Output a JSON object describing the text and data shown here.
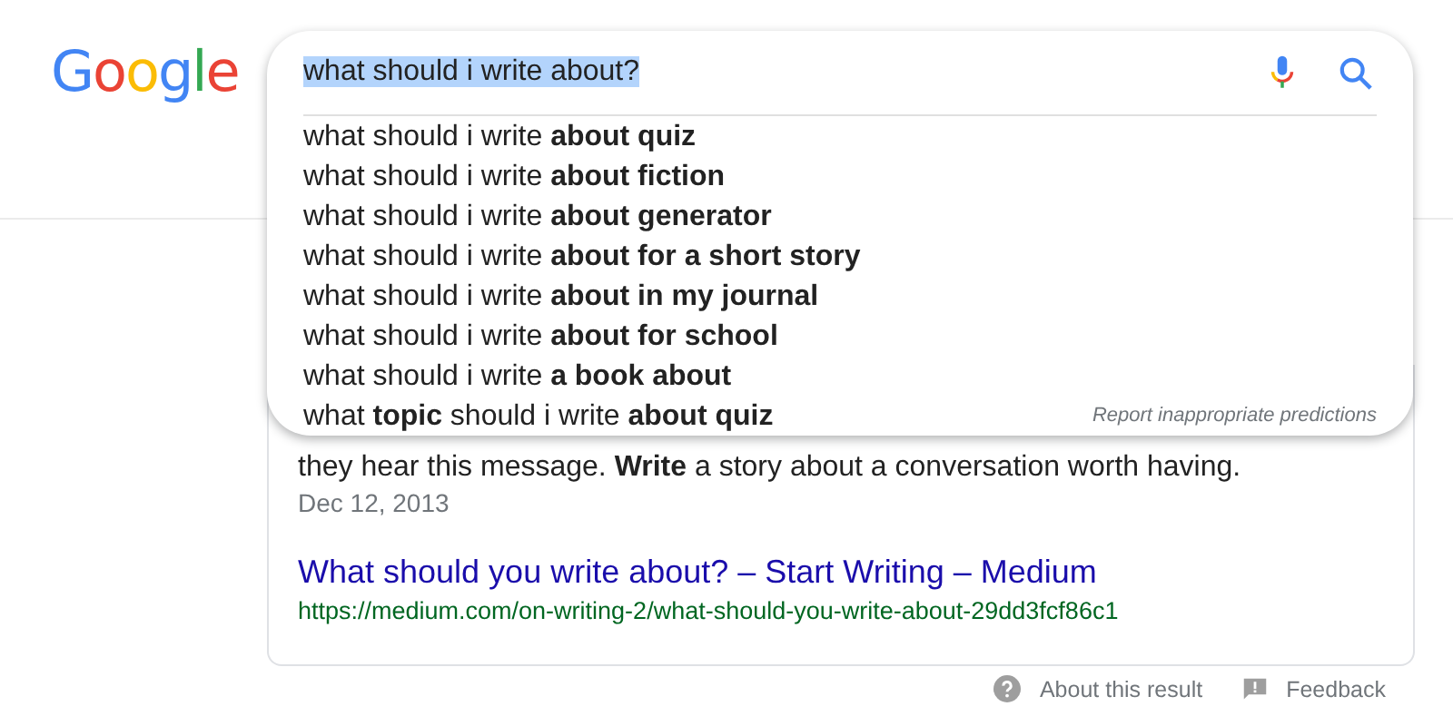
{
  "logo": "Google",
  "search": {
    "value": "what should i write about?",
    "text_selected": true
  },
  "suggestions": [
    {
      "text": "what should i write **about quiz**"
    },
    {
      "text": "what should i write **about fiction**"
    },
    {
      "text": "what should i write **about generator**"
    },
    {
      "text": "what should i write **about for a short story**"
    },
    {
      "text": "what should i write **about in my journal**"
    },
    {
      "text": "what should i write **about for school**"
    },
    {
      "text": "what should i write **a book about**"
    },
    {
      "text": "what **topic** should i write **about quiz**"
    }
  ],
  "report_link": "Report inappropriate predictions",
  "result": {
    "snippet": "they hear this message. **Write** a story about a conversation worth having.",
    "date": "Dec 12, 2013",
    "title": "What should you write about? – Start Writing – Medium",
    "url": "https://medium.com/on-writing-2/what-should-you-write-about-29dd3fcf86c1"
  },
  "footer": [
    {
      "kind": "about",
      "label": "About this result"
    },
    {
      "kind": "feedback",
      "label": "Feedback"
    }
  ]
}
